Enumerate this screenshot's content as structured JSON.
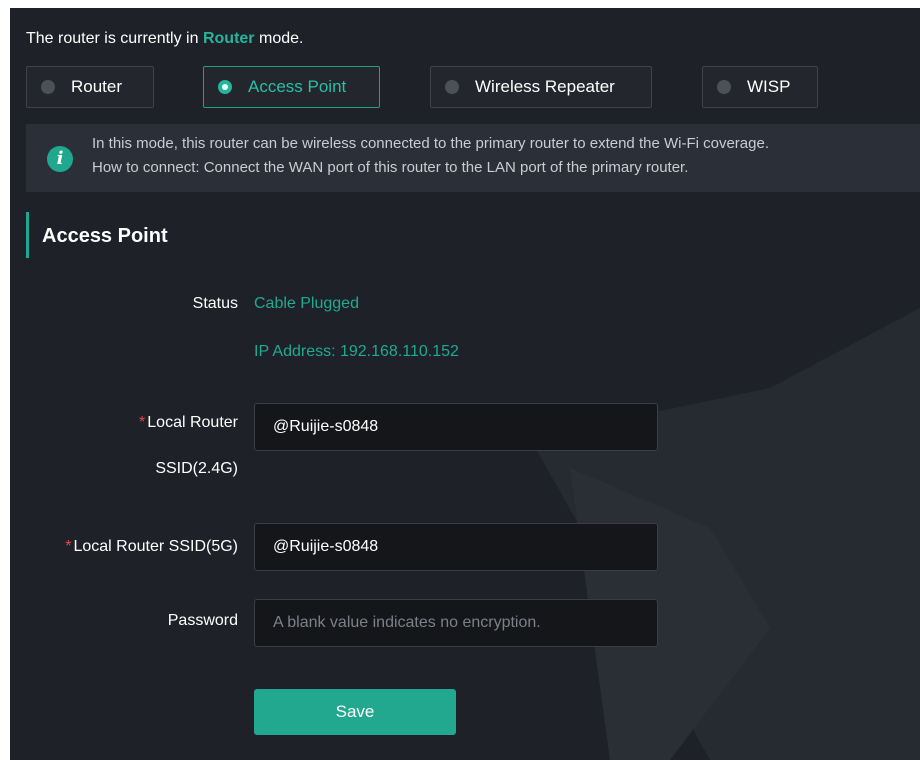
{
  "header": {
    "mode_prefix": "The router is currently in",
    "mode_current": "Router",
    "mode_suffix": "mode."
  },
  "mode_options": [
    {
      "label": "Router",
      "selected": false
    },
    {
      "label": "Access Point",
      "selected": true
    },
    {
      "label": "Wireless Repeater",
      "selected": false
    },
    {
      "label": "WISP",
      "selected": false
    }
  ],
  "info": {
    "icon": "info-icon",
    "line1": "In this mode, this router can be wireless connected to the primary router to extend the Wi-Fi coverage.",
    "line2": "How to connect: Connect the WAN port of this router to the LAN port of the primary router."
  },
  "section": {
    "title": "Access Point"
  },
  "form": {
    "status_label": "Status",
    "status_value": "Cable Plugged",
    "ip_text": "IP Address: 192.168.110.152",
    "required_mark": "*",
    "ssid24_label_line1": "Local Router",
    "ssid24_label_line2": "SSID(2.4G)",
    "ssid24_value": "@Ruijie-s0848",
    "ssid5_label": "Local Router SSID(5G)",
    "ssid5_value": "@Ruijie-s0848",
    "password_label": "Password",
    "password_value": "",
    "password_placeholder": "A blank value indicates no encryption.",
    "save_label": "Save"
  },
  "colors": {
    "accent": "#21a88e",
    "background": "#1e2128",
    "required": "#e5484d"
  }
}
